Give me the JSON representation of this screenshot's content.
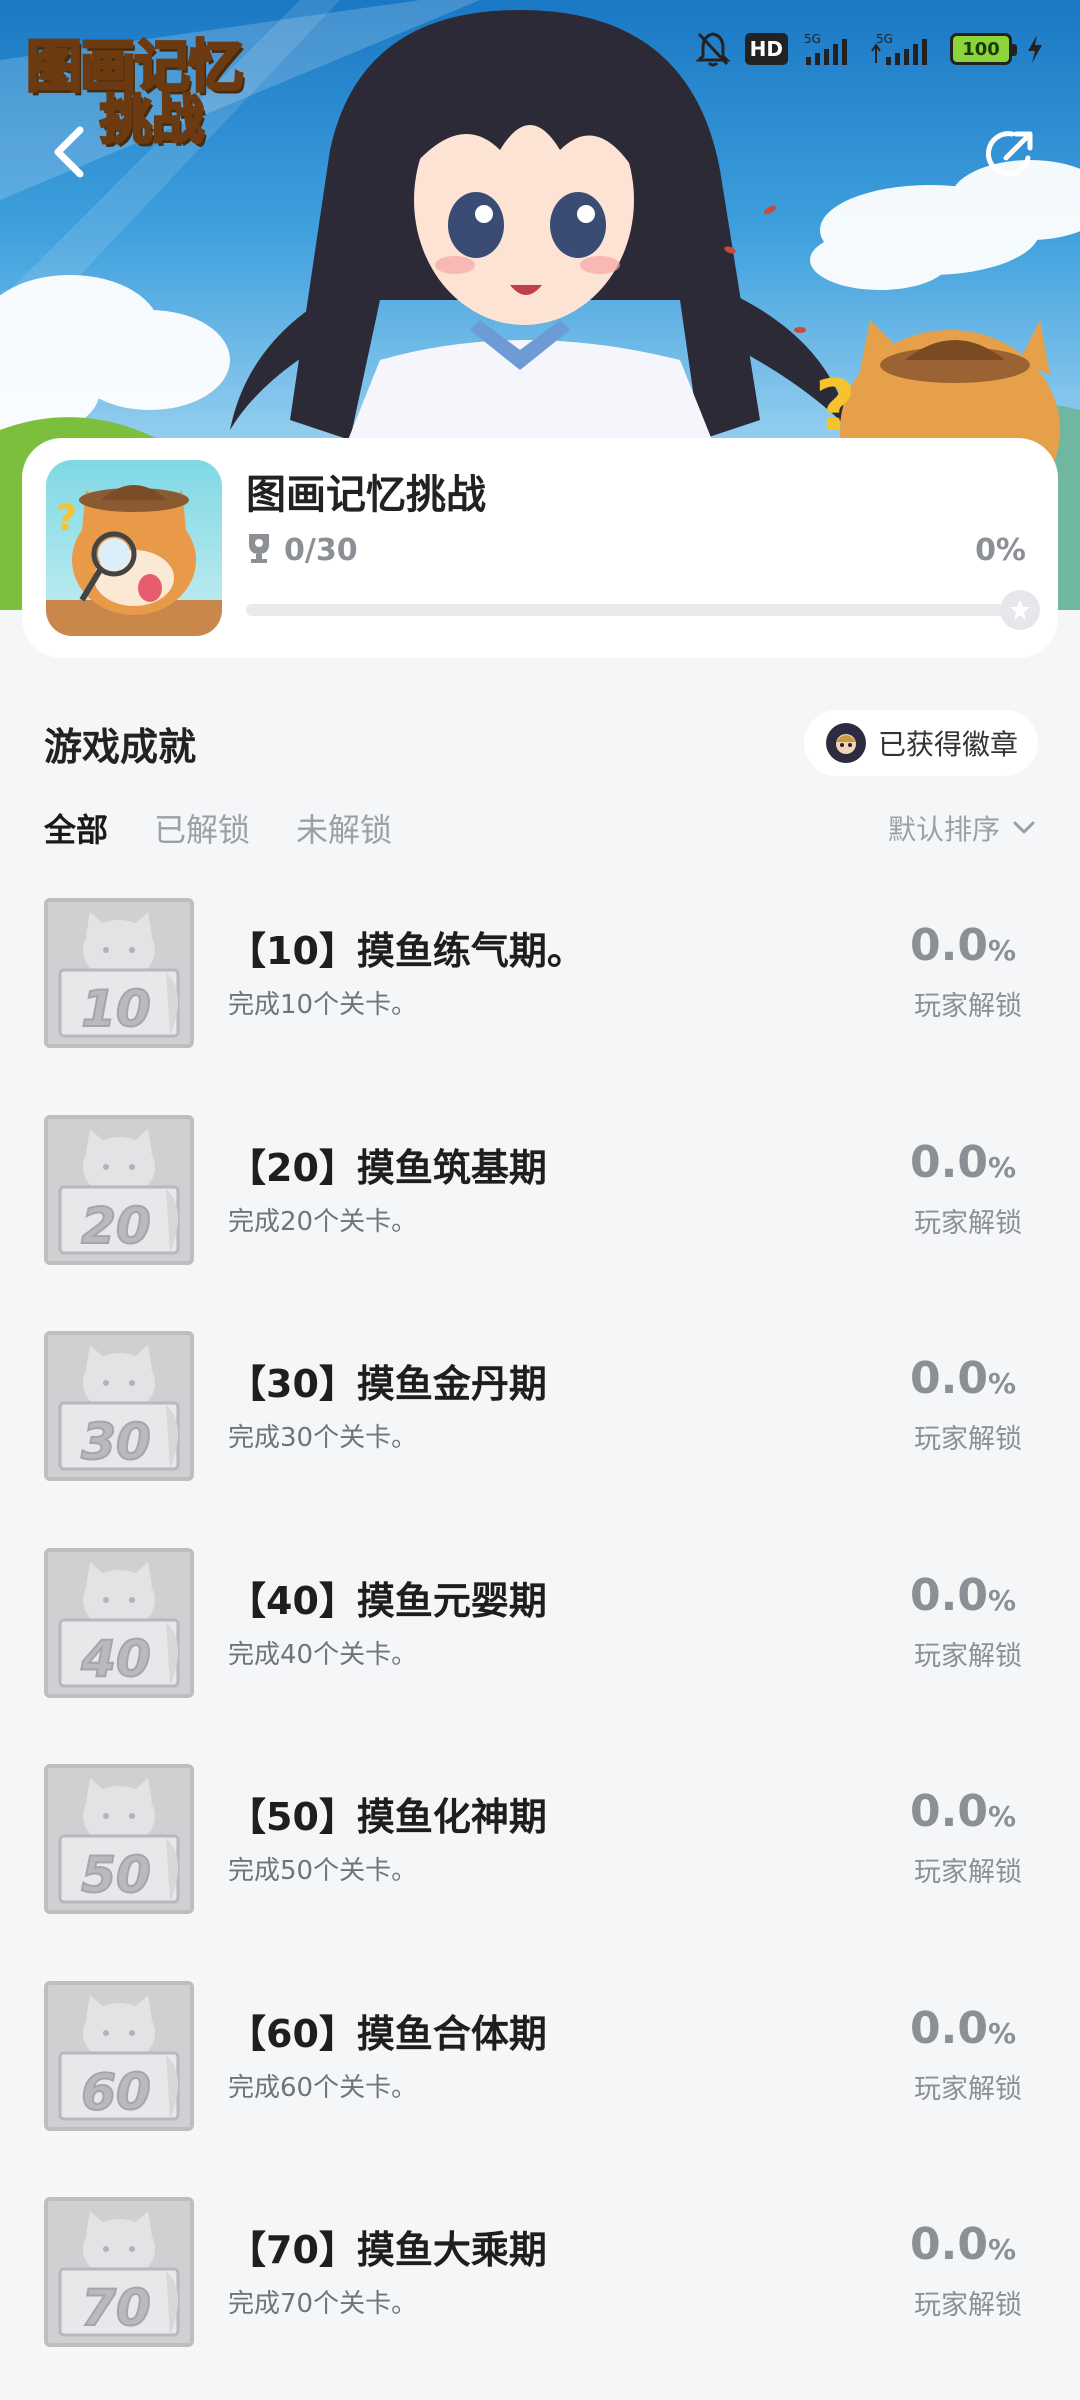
{
  "status_bar": {
    "icons": [
      "bell-off-icon",
      "hd-icon",
      "signal-5g-icon",
      "signal-5g-icon",
      "battery-icon",
      "charging-icon"
    ],
    "hd_label": "HD",
    "battery_level": "100"
  },
  "header": {
    "logo_line1": "图画记忆",
    "logo_line2": "挑战",
    "back_icon": "back-arrow-icon",
    "share_icon": "share-icon"
  },
  "game": {
    "title": "图画记忆挑战",
    "achieved": "0/30",
    "percent": "0%",
    "progress_fraction": 0
  },
  "achievements_section": {
    "title": "游戏成就",
    "badge_button": "已获得徽章",
    "tabs": [
      "全部",
      "已解锁",
      "未解锁"
    ],
    "active_tab": 0,
    "sort_label": "默认排序"
  },
  "achievements": [
    {
      "badge_number": "10",
      "name": "【10】摸鱼练气期。",
      "desc": "完成10个关卡。",
      "rate": "0.0",
      "rate_unit": "%",
      "rate_label": "玩家解锁"
    },
    {
      "badge_number": "20",
      "name": "【20】摸鱼筑基期",
      "desc": "完成20个关卡。",
      "rate": "0.0",
      "rate_unit": "%",
      "rate_label": "玩家解锁"
    },
    {
      "badge_number": "30",
      "name": "【30】摸鱼金丹期",
      "desc": "完成30个关卡。",
      "rate": "0.0",
      "rate_unit": "%",
      "rate_label": "玩家解锁"
    },
    {
      "badge_number": "40",
      "name": "【40】摸鱼元婴期",
      "desc": "完成40个关卡。",
      "rate": "0.0",
      "rate_unit": "%",
      "rate_label": "玩家解锁"
    },
    {
      "badge_number": "50",
      "name": "【50】摸鱼化神期",
      "desc": "完成50个关卡。",
      "rate": "0.0",
      "rate_unit": "%",
      "rate_label": "玩家解锁"
    },
    {
      "badge_number": "60",
      "name": "【60】摸鱼合体期",
      "desc": "完成60个关卡。",
      "rate": "0.0",
      "rate_unit": "%",
      "rate_label": "玩家解锁"
    },
    {
      "badge_number": "70",
      "name": "【70】摸鱼大乘期",
      "desc": "完成70个关卡。",
      "rate": "0.0",
      "rate_unit": "%",
      "rate_label": "玩家解锁"
    }
  ],
  "colors": {
    "page_bg": "#f5f6f8",
    "text_primary": "#1e1e1e",
    "text_muted": "#8c9096",
    "card_bg": "#ffffff"
  }
}
